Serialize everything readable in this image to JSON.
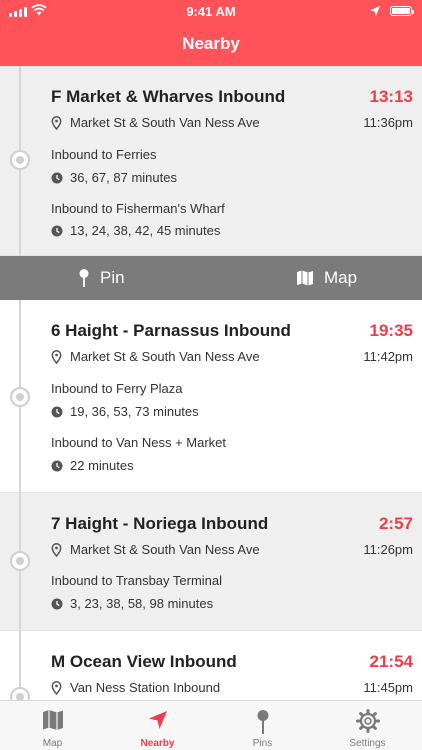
{
  "status_bar": {
    "time": "9:41 AM"
  },
  "header": {
    "title": "Nearby"
  },
  "routes": [
    {
      "name": "F Market & Wharves Inbound",
      "countdown": "13:13",
      "stop": "Market St & South Van Ness Ave",
      "clock_time": "11:36pm",
      "destinations": [
        {
          "label": "Inbound to Ferries",
          "minutes": "36, 67, 87 minutes"
        },
        {
          "label": "Inbound to Fisherman's Wharf",
          "minutes": "13, 24, 38, 42, 45 minutes"
        }
      ]
    },
    {
      "name": "6 Haight - Parnassus Inbound",
      "countdown": "19:35",
      "stop": "Market St & South Van Ness Ave",
      "clock_time": "11:42pm",
      "destinations": [
        {
          "label": "Inbound to Ferry Plaza",
          "minutes": "19, 36, 53, 73 minutes"
        },
        {
          "label": "Inbound to Van Ness + Market",
          "minutes": "22 minutes"
        }
      ]
    },
    {
      "name": "7 Haight - Noriega Inbound",
      "countdown": "2:57",
      "stop": "Market St & South Van Ness Ave",
      "clock_time": "11:26pm",
      "destinations": [
        {
          "label": "Inbound to Transbay Terminal",
          "minutes": "3, 23, 38, 58, 98 minutes"
        }
      ]
    },
    {
      "name": "M Ocean View Inbound",
      "countdown": "21:54",
      "stop": "Van Ness Station Inbound",
      "clock_time": "11:45pm"
    }
  ],
  "actions": {
    "pin_label": "Pin",
    "map_label": "Map"
  },
  "tabs": [
    {
      "label": "Map",
      "icon": "map-icon"
    },
    {
      "label": "Nearby",
      "icon": "navigation-arrow-icon",
      "active": true
    },
    {
      "label": "Pins",
      "icon": "pin-icon"
    },
    {
      "label": "Settings",
      "icon": "gear-icon"
    }
  ],
  "colors": {
    "header": "#ff5359",
    "accent": "#ef3e4a",
    "action_bar": "#7b7b7b"
  }
}
